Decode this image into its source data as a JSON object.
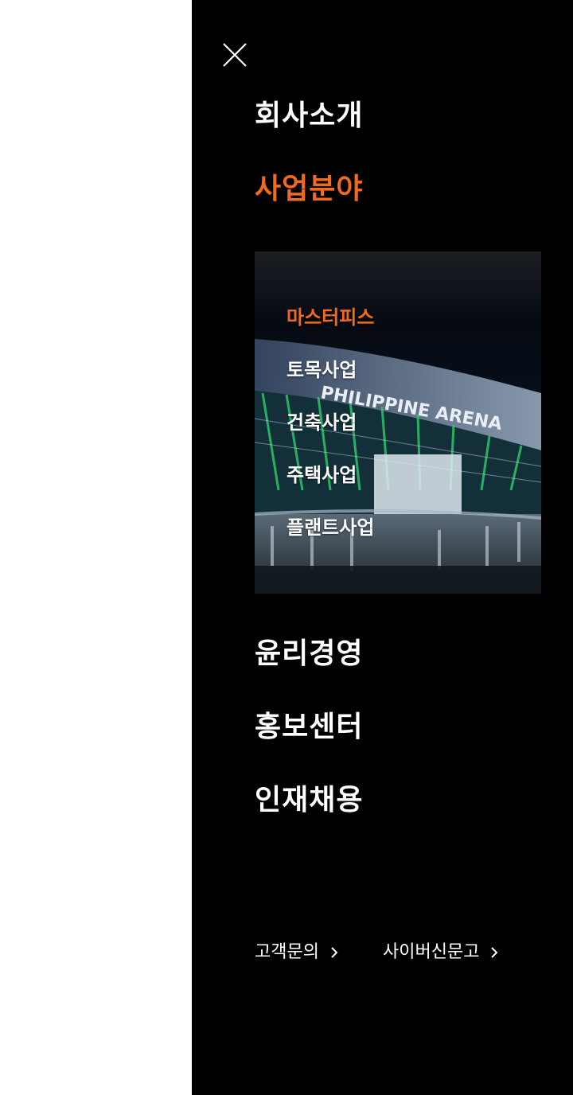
{
  "main_menu": [
    {
      "label": "회사소개",
      "active": false
    },
    {
      "label": "사업분야",
      "active": true
    },
    {
      "label": "윤리경영",
      "active": false
    },
    {
      "label": "홍보센터",
      "active": false
    },
    {
      "label": "인재채용",
      "active": false
    }
  ],
  "submenu": {
    "background_sign": "PHILIPPINE ARENA",
    "items": [
      {
        "label": "마스터피스",
        "active": true
      },
      {
        "label": "토목사업",
        "active": false
      },
      {
        "label": "건축사업",
        "active": false
      },
      {
        "label": "주택사업",
        "active": false
      },
      {
        "label": "플랜트사업",
        "active": false
      }
    ]
  },
  "footer": {
    "links": [
      {
        "label": "고객문의"
      },
      {
        "label": "사이버신문고"
      }
    ]
  },
  "colors": {
    "accent": "#f26b1d",
    "drawer_bg": "#000000",
    "text": "#ffffff"
  },
  "icons": {
    "close": "close-icon",
    "chevron": "chevron-right-icon"
  }
}
